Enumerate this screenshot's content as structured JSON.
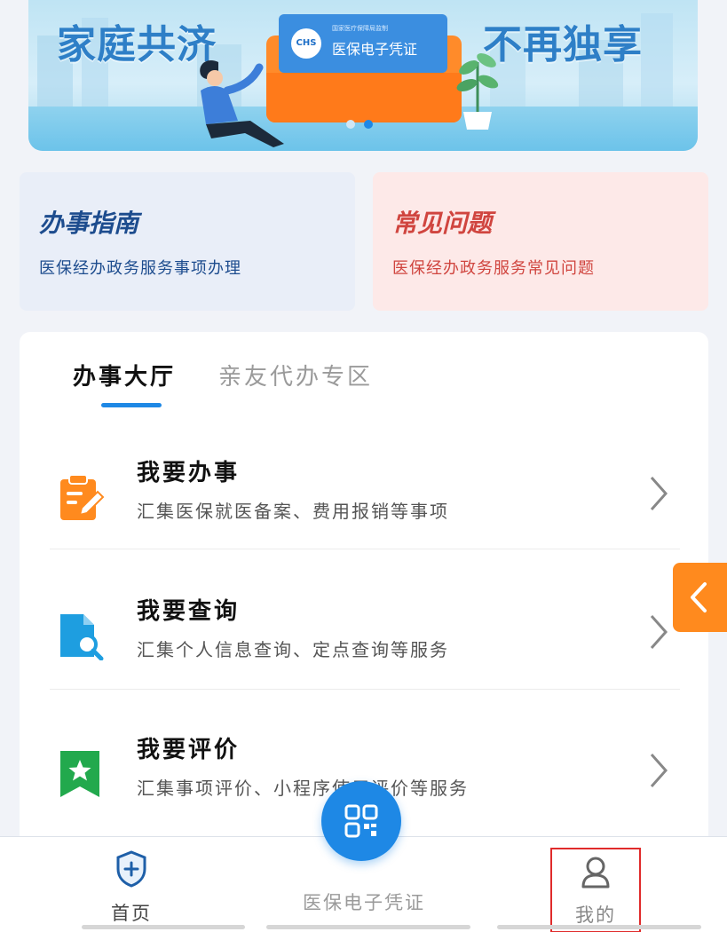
{
  "banner": {
    "left_text": "家庭共济",
    "right_text": "不再独享",
    "card_title": "医保电子凭证",
    "card_subtitle": "国家医疗保障局监制",
    "card_logo_text": "CHS",
    "slides_total": 2,
    "slide_active": 2
  },
  "guide": {
    "title": "办事指南",
    "subtitle": "医保经办政务服务事项办理"
  },
  "faq": {
    "title": "常见问题",
    "subtitle": "医保经办政务服务常见问题"
  },
  "hall": {
    "tabs": [
      {
        "label": "办事大厅",
        "active": true
      },
      {
        "label": "亲友代办专区",
        "active": false
      }
    ],
    "services": [
      {
        "title": "我要办事",
        "desc": "汇集医保就医备案、费用报销等事项",
        "icon": "clipboard-edit-icon",
        "color": "#ff8a1e"
      },
      {
        "title": "我要查询",
        "desc": "汇集个人信息查询、定点查询等服务",
        "icon": "document-search-icon",
        "color": "#1e9ee0"
      },
      {
        "title": "我要评价",
        "desc": "汇集事项评价、小程序使用评价等服务",
        "icon": "star-bookmark-icon",
        "color": "#22a94d"
      }
    ]
  },
  "side_tab": {
    "icon": "chevron-left-icon",
    "color": "#ff8a1e"
  },
  "nav": {
    "home_label": "首页",
    "cert_label": "医保电子凭证",
    "mine_label": "我的",
    "home_icon": "shield-plus-icon",
    "cert_icon": "qr-code-icon",
    "mine_icon": "user-icon"
  },
  "colors": {
    "accent": "#1e88e5",
    "highlight_box": "#e02b2b"
  }
}
